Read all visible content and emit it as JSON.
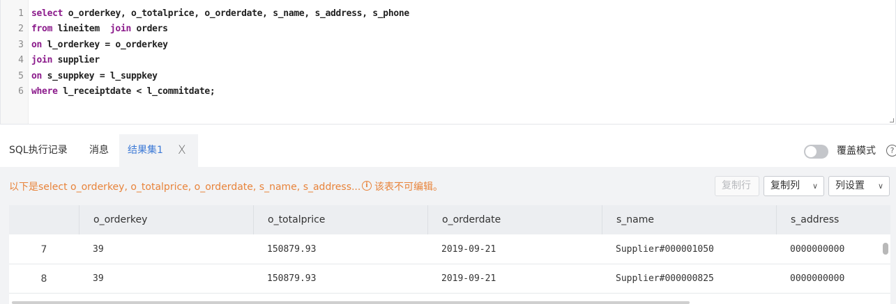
{
  "editor": {
    "lines": [
      {
        "no": "1",
        "kw": "select",
        "rest": " o_orderkey, o_totalprice, o_orderdate, s_name, s_address, s_phone"
      },
      {
        "no": "2",
        "kw": "from",
        "rest": " lineitem  ",
        "kw2": "join",
        "rest2": " orders"
      },
      {
        "no": "3",
        "kw": "on",
        "rest": " l_orderkey = o_orderkey"
      },
      {
        "no": "4",
        "kw": "join",
        "rest": " supplier"
      },
      {
        "no": "5",
        "kw": "on",
        "rest": " s_suppkey = l_suppkey"
      },
      {
        "no": "6",
        "kw": "where",
        "rest": " l_receiptdate < l_commitdate;"
      }
    ]
  },
  "tabs": {
    "history": "SQL执行记录",
    "messages": "消息",
    "result": "结果集1",
    "close": "X"
  },
  "overwrite": {
    "label": "覆盖模式",
    "enabled": false,
    "help": "?"
  },
  "result": {
    "info": "以下是select o_orderkey, o_totalprice, o_orderdate, s_name, s_address...",
    "warning_icon": "i",
    "warning": "该表不可编辑。",
    "buttons": {
      "copy_row": "复制行",
      "copy_col": "复制列",
      "col_settings": "列设置"
    },
    "caret": "∨"
  },
  "table": {
    "columns": [
      "o_orderkey",
      "o_totalprice",
      "o_orderdate",
      "s_name",
      "s_address"
    ],
    "rows": [
      {
        "idx": "7",
        "cells": [
          "39",
          "150879.93",
          "2019-09-21",
          "Supplier#000001050",
          "0000000000"
        ]
      },
      {
        "idx": "8",
        "cells": [
          "39",
          "150879.93",
          "2019-09-21",
          "Supplier#000000825",
          "0000000000"
        ]
      }
    ]
  },
  "colors": {
    "accent": "#3d7ad6",
    "warning": "#e8833a",
    "keyword": "#8b1a8b"
  }
}
